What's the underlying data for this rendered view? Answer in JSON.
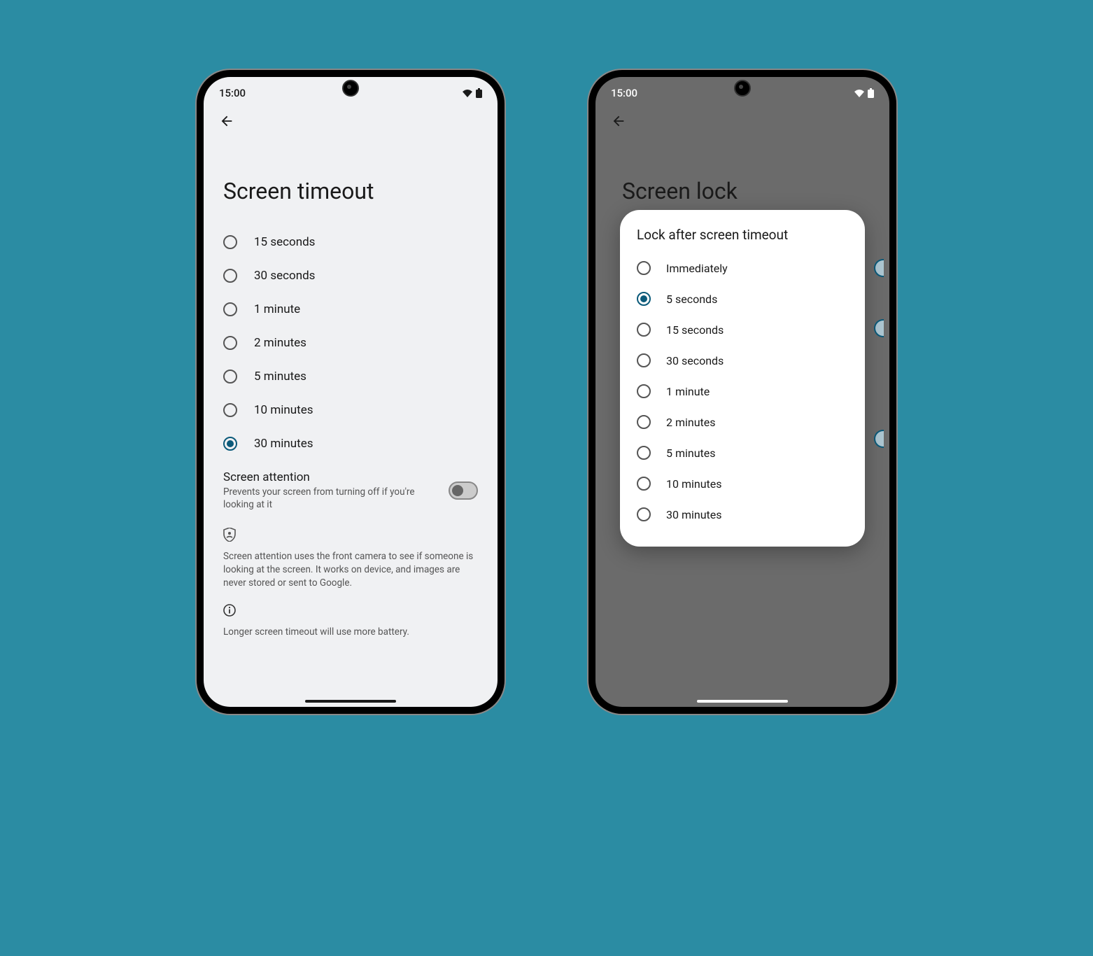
{
  "status": {
    "time": "15:00"
  },
  "left": {
    "title": "Screen timeout",
    "options": [
      {
        "label": "15 seconds",
        "checked": false
      },
      {
        "label": "30 seconds",
        "checked": false
      },
      {
        "label": "1 minute",
        "checked": false
      },
      {
        "label": "2 minutes",
        "checked": false
      },
      {
        "label": "5 minutes",
        "checked": false
      },
      {
        "label": "10 minutes",
        "checked": false
      },
      {
        "label": "30 minutes",
        "checked": true
      }
    ],
    "attention": {
      "title": "Screen attention",
      "sub": "Prevents your screen from turning off if you're looking at it",
      "on": false
    },
    "privacy_text": "Screen attention uses the front camera to see if someone is looking at the screen. It works on device, and images are never stored or sent to Google.",
    "footer": "Longer screen timeout will use more battery."
  },
  "right": {
    "title": "Screen lock",
    "dialog": {
      "title": "Lock after screen timeout",
      "options": [
        {
          "label": "Immediately",
          "checked": false
        },
        {
          "label": "5 seconds",
          "checked": true
        },
        {
          "label": "15 seconds",
          "checked": false
        },
        {
          "label": "30 seconds",
          "checked": false
        },
        {
          "label": "1 minute",
          "checked": false
        },
        {
          "label": "2 minutes",
          "checked": false
        },
        {
          "label": "5 minutes",
          "checked": false
        },
        {
          "label": "10 minutes",
          "checked": false
        },
        {
          "label": "30 minutes",
          "checked": false
        }
      ]
    }
  }
}
